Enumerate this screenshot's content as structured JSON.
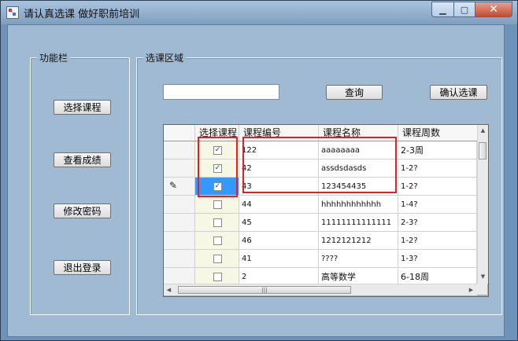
{
  "window": {
    "title": "请认真选课 做好职前培训",
    "controls": [
      "▁",
      "▢",
      "✕"
    ]
  },
  "sidebar": {
    "title": "功能栏",
    "buttons": [
      "选择课程",
      "查看成绩",
      "修改密码",
      "退出登录"
    ]
  },
  "course_area": {
    "title": "选课区域",
    "search_value": "",
    "query_label": "查询",
    "confirm_label": "确认选课"
  },
  "grid": {
    "columns": [
      "选择课程",
      "课程编号",
      "课程名称",
      "课程周数"
    ],
    "rows": [
      {
        "checked": true,
        "id": "122",
        "name": "aaaaaaaa",
        "weeks": "2-3周"
      },
      {
        "checked": true,
        "id": "42",
        "name": "assdsdasds",
        "weeks": "1-2?"
      },
      {
        "checked": true,
        "id": "43",
        "name": "123454435",
        "weeks": "1-2?",
        "selected": true
      },
      {
        "checked": false,
        "id": "44",
        "name": "hhhhhhhhhhhh",
        "weeks": "1-4?"
      },
      {
        "checked": false,
        "id": "45",
        "name": "11111111111111",
        "weeks": "2-3?"
      },
      {
        "checked": false,
        "id": "46",
        "name": "1212121212",
        "weeks": "1-2?"
      },
      {
        "checked": false,
        "id": "41",
        "name": "????",
        "weeks": "1-3?"
      },
      {
        "checked": false,
        "id": "2",
        "name": "高等数学",
        "weeks": "6-18周"
      }
    ],
    "checkmark": "✓",
    "edit_icon_glyph": "✎",
    "scroll_glyphs": {
      "up": "▲",
      "down": "▼",
      "left": "◀",
      "right": "▶",
      "grip": "≡",
      "hgrip": "|||"
    }
  },
  "colors": {
    "highlight": "#e21f25",
    "selection": "#3399ff"
  }
}
